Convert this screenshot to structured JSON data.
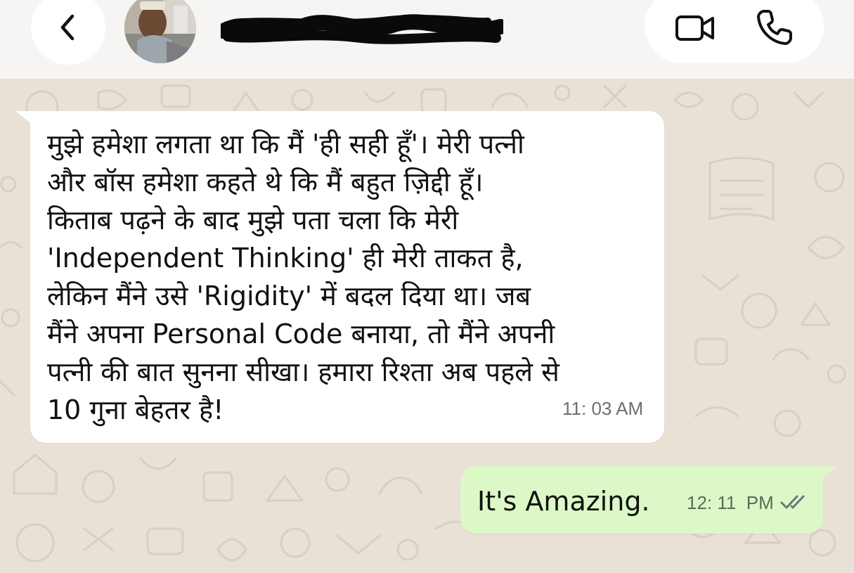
{
  "header": {
    "back_icon": "chevron-left-icon",
    "avatar_alt": "",
    "contact_name": "",
    "video_icon": "video-camera-icon",
    "phone_icon": "phone-icon"
  },
  "messages": [
    {
      "direction": "incoming",
      "text": "मुझे हमेशा लगता था कि मैं 'ही सही हूँ'। मेरी पत्नी\nऔर बॉस हमेशा कहते थे कि मैं बहुत ज़िद्दी हूँ।\nकिताब पढ़ने के बाद मुझे पता चला कि मेरी\n'Independent Thinking' ही मेरी ताकत है,\nलेकिन मैंने उसे 'Rigidity' में बदल दिया था। जब\nमैंने अपना Personal Code बनाया, तो मैंने अपनी\nपत्नी की बात सुनना सीखा। हमारा रिश्ता अब पहले से\n10 गुना बेहतर है!",
      "time": "11: 03 AM"
    },
    {
      "direction": "outgoing",
      "text": "It's Amazing.",
      "time": "12: 11  PM",
      "status_icon": "double-check-icon"
    }
  ],
  "colors": {
    "wallpaper": "#e9e1d6",
    "header_bg": "#f6f5f3",
    "incoming_bubble": "#ffffff",
    "outgoing_bubble": "#dcf8c6",
    "tick_color": "#667781"
  }
}
